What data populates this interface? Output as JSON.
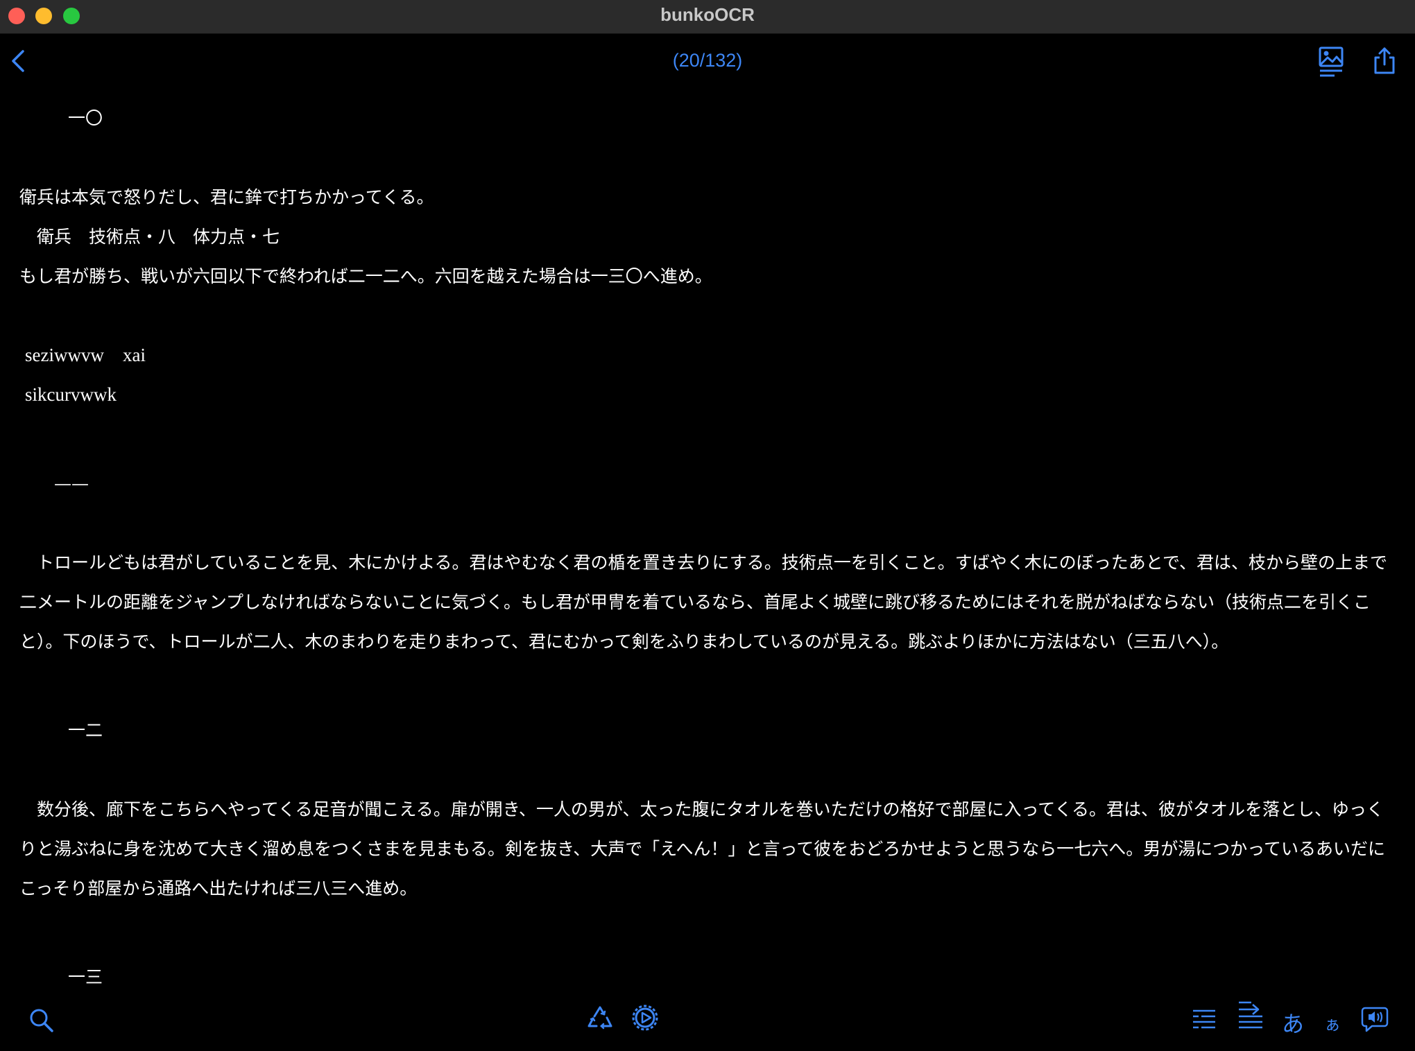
{
  "window": {
    "title": "bunkoOCR"
  },
  "toolbar": {
    "page_counter": "(20/132)"
  },
  "content": {
    "sec1_heading": "一〇",
    "sec1_p1": "衛兵は本気で怒りだし、君に鉾で打ちかかってくる。",
    "sec1_p2": "　衛兵　技術点・八　体力点・七",
    "sec1_p3": "もし君が勝ち、戦いが六回以下で終われば二一二へ。六回を越えた場合は一三〇へ進め。",
    "latin1": "seziwwvw　xai",
    "latin2": "sikcurvwwk",
    "sec2_heading": "——",
    "sec2_p1": "　トロールどもは君がしていることを見、木にかけよる。君はやむなく君の楯を置き去りにする。技術点一を引くこと。すばやく木にのぼったあとで、君は、枝から壁の上まで二メートルの距離をジャンプしなければならないことに気づく。もし君が甲冑を着ているなら、首尾よく城壁に跳び移るためにはそれを脱がねばならない（技術点二を引くこと）。下のほうで、トロールが二人、木のまわりを走りまわって、君にむかって剣をふりまわしているのが見える。跳ぶよりほかに方法はない（三五八へ）。",
    "sec3_heading": "一二",
    "sec3_p1": "　数分後、廊下をこちらへやってくる足音が聞こえる。扉が開き、一人の男が、太った腹にタオルを巻いただけの格好で部屋に入ってくる。君は、彼がタオルを落とし、ゆっくりと湯ぶねに身を沈めて大きく溜め息をつくさまを見まもる。剣を抜き、大声で「えへん！」と言って彼をおどろかせようと思うなら一七六へ。男が湯につかっているあいだにこっそり部屋から通路へ出たければ三八三へ進め。",
    "sec4_heading": "一三"
  },
  "bottom": {
    "kana_large": "あ",
    "kana_small": "ぁ"
  },
  "icons": {
    "back": "chevron-left-icon",
    "image": "image-icon",
    "share": "share-icon",
    "search": "magnifier-icon",
    "recycle": "recycle-icon",
    "settings": "gear-icon",
    "list": "list-icon",
    "align": "text-align-icon",
    "speech": "speech-bubble-icon"
  },
  "colors": {
    "accent": "#3d86f5",
    "background": "#000000",
    "titlebar": "#2b2b2b"
  }
}
